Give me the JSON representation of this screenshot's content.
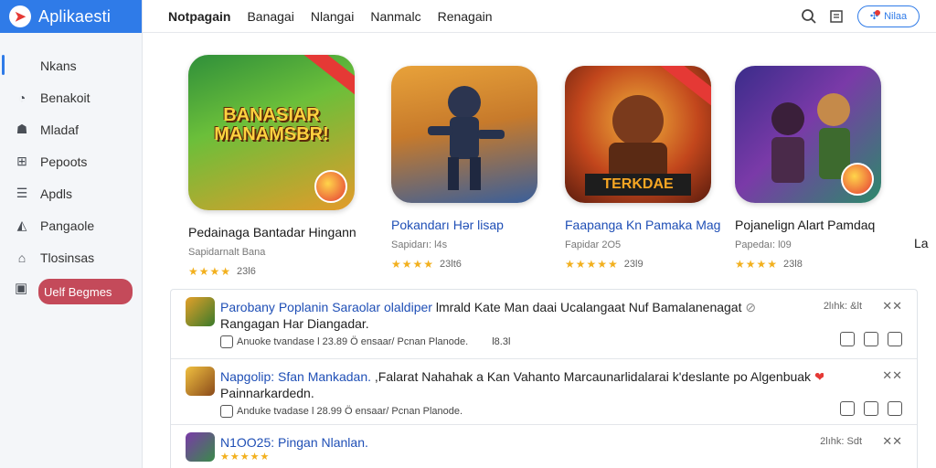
{
  "app": {
    "name": "Aplikaesti"
  },
  "sidebar": {
    "items": [
      {
        "label": "Nkans",
        "icon": "home-icon"
      },
      {
        "label": "Benakoit",
        "icon": "clock-icon"
      },
      {
        "label": "Mladaf",
        "icon": "users-icon"
      },
      {
        "label": "Pepoots",
        "icon": "chart-icon"
      },
      {
        "label": "Apdls",
        "icon": "list-icon"
      },
      {
        "label": "Pangaole",
        "icon": "tag-icon"
      },
      {
        "label": "Tlosinsas",
        "icon": "house-icon"
      },
      {
        "label": "Uelf Begmes",
        "icon": "library-icon"
      }
    ]
  },
  "topbar": {
    "tabs": [
      "Notpagain",
      "Banagai",
      "Nlangai",
      "Nanmalc",
      "Renagain"
    ],
    "pill_label": "Nilaa"
  },
  "cards": [
    {
      "title": "Pedainaga Bantadar Hingann",
      "sub": "Sapidarnalt Bana",
      "rating": "23l6",
      "art_text": "BANASIAR MANAMSBR!"
    },
    {
      "title": "Pokandarı Hər lisap",
      "sub": "Sapidarı: l4s",
      "rating": "23lt6"
    },
    {
      "title": "Faapanga Kn Pamaka Mag",
      "sub": "Fapidar 2O5",
      "rating": "23l9",
      "art_text": "TERKDAE"
    },
    {
      "title": "Pojanelign Alart Pamdaq",
      "sub": "Papedaı: l09",
      "rating": "23l8"
    },
    {
      "title": "La"
    }
  ],
  "rows": [
    {
      "title_link": "Parobany Poplanin Saraolar olaldiper",
      "title_rest": " lmrald Kate Man daai Ucalangaat Nuf Bamalanenagat",
      "line2": "Rangagan Har Diangadar.",
      "meta_author": "Anuoke tvandase",
      "meta_date": "l 23.89  Ö ensaar/ Pcnan Planode.",
      "meta_time": "l8.3l",
      "stamp": "2lıhk: &lt",
      "close": "✕✕"
    },
    {
      "title_link": "Napgolip: Sfan Mankadan.",
      "title_rest": " ,Falarat Nahahak a Kan Vahanto Marcaunarlidalarai k'deslante po Algenbuak",
      "line2": "Painnarkardedn.",
      "meta_author": "Anduke tvadase",
      "meta_date": "l 28.99  Ö ensaar/ Pcnan Planode.",
      "stamp": "",
      "close": "✕✕"
    },
    {
      "title_link": "N1OO25: Pingan Nlanlan.",
      "title_rest": "",
      "line2": "",
      "stars": "★★★★★",
      "stamp": "2lıhk: Sdt",
      "close": "✕✕"
    }
  ],
  "colors": {
    "accent": "#2f7be8",
    "highlight": "#c44a5a",
    "link": "#1f4fb6",
    "star": "#f2b01e"
  }
}
